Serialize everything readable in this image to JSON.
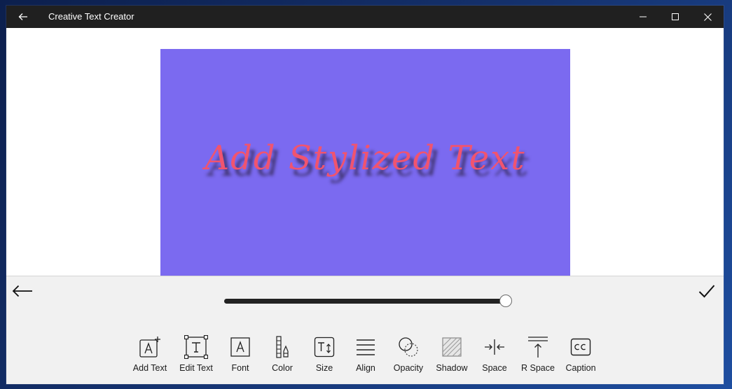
{
  "window": {
    "title": "Creative Text Creator"
  },
  "canvas": {
    "text": "Add Stylized Text",
    "background_color": "#7b6af0",
    "text_color": "#f0546f"
  },
  "slider": {
    "value": 1.0
  },
  "tools": [
    {
      "label": "Add Text",
      "icon": "add-text-icon"
    },
    {
      "label": "Edit Text",
      "icon": "edit-text-icon"
    },
    {
      "label": "Font",
      "icon": "font-icon"
    },
    {
      "label": "Color",
      "icon": "color-icon"
    },
    {
      "label": "Size",
      "icon": "size-icon"
    },
    {
      "label": "Align",
      "icon": "align-icon"
    },
    {
      "label": "Opacity",
      "icon": "opacity-icon"
    },
    {
      "label": "Shadow",
      "icon": "shadow-icon"
    },
    {
      "label": "Space",
      "icon": "space-icon"
    },
    {
      "label": "R Space",
      "icon": "row-space-icon"
    },
    {
      "label": "Caption",
      "icon": "caption-icon"
    }
  ]
}
